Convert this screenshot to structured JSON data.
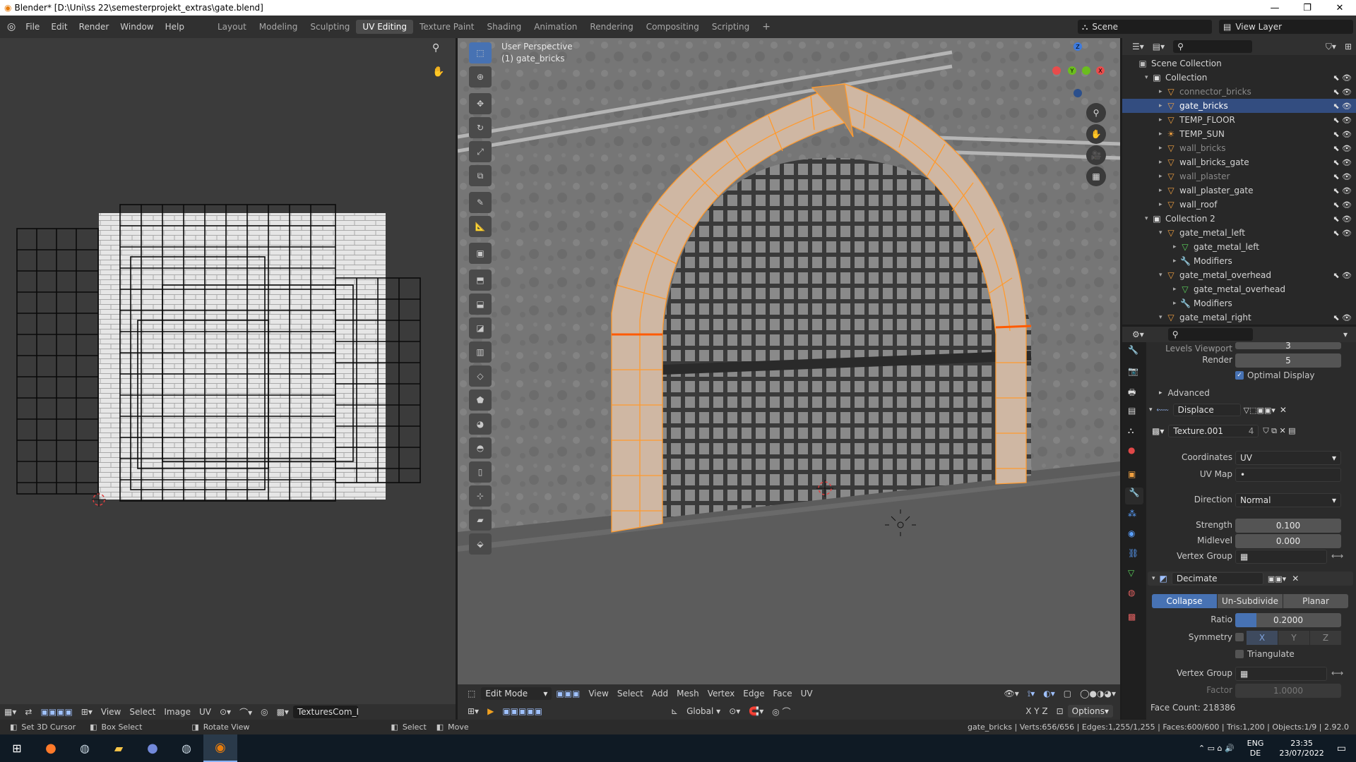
{
  "titlebar": {
    "title": "Blender* [D:\\Uni\\ss 22\\semesterprojekt_extras\\gate.blend]",
    "min": "—",
    "max": "❐",
    "close": "✕"
  },
  "menu": [
    "File",
    "Edit",
    "Render",
    "Window",
    "Help"
  ],
  "workspaces": [
    "Layout",
    "Modeling",
    "Sculpting",
    "UV Editing",
    "Texture Paint",
    "Shading",
    "Animation",
    "Rendering",
    "Compositing",
    "Scripting"
  ],
  "active_workspace": "UV Editing",
  "scene": {
    "label": "Scene",
    "view_layer": "View Layer"
  },
  "uv_header": {
    "view": "View",
    "select": "Select",
    "image": "Image",
    "uv": "UV",
    "image_name": "TexturesCom_Bri"
  },
  "viewport": {
    "info_line1": "User Perspective",
    "info_line2": "(1) gate_bricks",
    "mode": "Edit Mode",
    "menus": [
      "View",
      "Select",
      "Add",
      "Mesh",
      "Vertex",
      "Edge",
      "Face",
      "UV"
    ],
    "orientation": "Global",
    "options": "Options",
    "axes": {
      "x": "X",
      "y": "Y",
      "z": "Z"
    },
    "gizmo_xyz": "X Y Z"
  },
  "outliner": {
    "search": "",
    "rows": [
      {
        "indent": 0,
        "tri": "",
        "name": "Scene Collection",
        "kind": "scene",
        "dim": false,
        "sel": false
      },
      {
        "indent": 1,
        "tri": "▾",
        "name": "Collection",
        "kind": "coll",
        "dim": false,
        "sel": false
      },
      {
        "indent": 2,
        "tri": "▸",
        "name": "connector_bricks",
        "kind": "mesh",
        "dim": true,
        "sel": false
      },
      {
        "indent": 2,
        "tri": "▸",
        "name": "gate_bricks",
        "kind": "mesh",
        "dim": false,
        "sel": true
      },
      {
        "indent": 2,
        "tri": "▸",
        "name": "TEMP_FLOOR",
        "kind": "mesh",
        "dim": false,
        "sel": false
      },
      {
        "indent": 2,
        "tri": "▸",
        "name": "TEMP_SUN",
        "kind": "light",
        "dim": false,
        "sel": false
      },
      {
        "indent": 2,
        "tri": "▸",
        "name": "wall_bricks",
        "kind": "mesh",
        "dim": true,
        "sel": false
      },
      {
        "indent": 2,
        "tri": "▸",
        "name": "wall_bricks_gate",
        "kind": "mesh",
        "dim": false,
        "sel": false
      },
      {
        "indent": 2,
        "tri": "▸",
        "name": "wall_plaster",
        "kind": "mesh",
        "dim": true,
        "sel": false
      },
      {
        "indent": 2,
        "tri": "▸",
        "name": "wall_plaster_gate",
        "kind": "mesh",
        "dim": false,
        "sel": false
      },
      {
        "indent": 2,
        "tri": "▸",
        "name": "wall_roof",
        "kind": "mesh",
        "dim": false,
        "sel": false
      },
      {
        "indent": 1,
        "tri": "▾",
        "name": "Collection 2",
        "kind": "coll",
        "dim": false,
        "sel": false
      },
      {
        "indent": 2,
        "tri": "▾",
        "name": "gate_metal_left",
        "kind": "mesh",
        "dim": false,
        "sel": false
      },
      {
        "indent": 3,
        "tri": "▸",
        "name": "gate_metal_left",
        "kind": "data",
        "dim": false,
        "sel": false
      },
      {
        "indent": 3,
        "tri": "▸",
        "name": "Modifiers",
        "kind": "mod",
        "dim": false,
        "sel": false
      },
      {
        "indent": 2,
        "tri": "▾",
        "name": "gate_metal_overhead",
        "kind": "mesh",
        "dim": false,
        "sel": false
      },
      {
        "indent": 3,
        "tri": "▸",
        "name": "gate_metal_overhead",
        "kind": "data",
        "dim": false,
        "sel": false
      },
      {
        "indent": 3,
        "tri": "▸",
        "name": "Modifiers",
        "kind": "mod",
        "dim": false,
        "sel": false
      },
      {
        "indent": 2,
        "tri": "▾",
        "name": "gate_metal_right",
        "kind": "mesh",
        "dim": false,
        "sel": false
      }
    ]
  },
  "props": {
    "levels_viewport_label": "Levels Viewport",
    "levels_viewport": "3",
    "render_label": "Render",
    "render": "5",
    "optimal_display": "Optimal Display",
    "advanced": "Advanced",
    "displace": {
      "name": "Displace",
      "texture": "Texture.001",
      "users": "4",
      "coordinates_label": "Coordinates",
      "coordinates": "UV",
      "uvmap_label": "UV Map",
      "uvmap": "•",
      "direction_label": "Direction",
      "direction": "Normal",
      "strength_label": "Strength",
      "strength": "0.100",
      "midlevel_label": "Midlevel",
      "midlevel": "0.000",
      "vgroup_label": "Vertex Group"
    },
    "decimate": {
      "name": "Decimate",
      "tabs": [
        "Collapse",
        "Un-Subdivide",
        "Planar"
      ],
      "ratio_label": "Ratio",
      "ratio": "0.2000",
      "ratio_fraction": 0.2,
      "symmetry_label": "Symmetry",
      "axes": [
        "X",
        "Y",
        "Z"
      ],
      "triangulate": "Triangulate",
      "vgroup_label": "Vertex Group",
      "factor_label": "Factor",
      "factor": "1.0000",
      "face_count": "Face Count: 218386"
    }
  },
  "status": {
    "left1": "Set 3D Cursor",
    "left2": "Box Select",
    "left3": "Rotate View",
    "mid1": "Select",
    "mid2": "Move",
    "stats": "gate_bricks | Verts:656/656 | Edges:1,255/1,255 | Faces:600/600 | Tris:1,200 | Objects:1/9 | 2.92.0"
  },
  "taskbar": {
    "lang1": "ENG",
    "lang2": "DE",
    "time": "23:35",
    "date": "23/07/2022"
  },
  "colors": {
    "accent": "#4772b3",
    "selection": "#334d80",
    "edge_orange": "#ff8c1a",
    "x_axis": "#e84c4c",
    "y_axis": "#6bbd1e",
    "z_axis": "#3d7be0"
  }
}
